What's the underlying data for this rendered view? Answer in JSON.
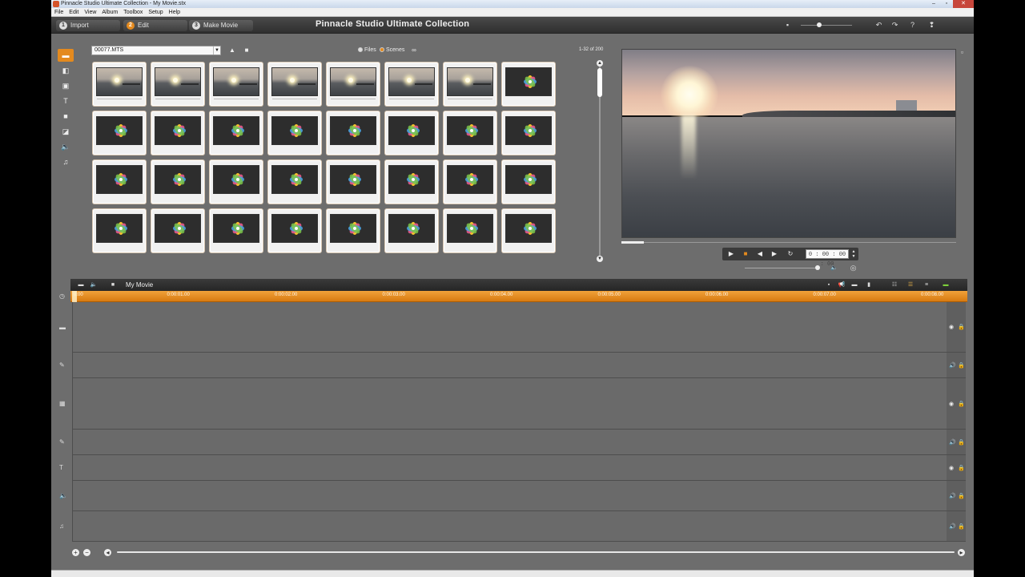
{
  "window": {
    "title": "Pinnacle Studio Ultimate Collection - My Movie.stx"
  },
  "menu": [
    "File",
    "Edit",
    "View",
    "Album",
    "Toolbox",
    "Setup",
    "Help"
  ],
  "nav": {
    "tabs": [
      {
        "num": "1",
        "label": "Import"
      },
      {
        "num": "2",
        "label": "Edit"
      },
      {
        "num": "3",
        "label": "Make Movie"
      }
    ],
    "active_tab": "Edit",
    "app_title": "Pinnacle Studio Ultimate Collection"
  },
  "toolbar_icons": [
    "video-scenes-icon",
    "transitions-icon",
    "photos-icon",
    "titles-icon",
    "menus-icon",
    "effects-icon",
    "sound-effects-icon",
    "music-icon"
  ],
  "library": {
    "file_selected": "00077.MTS",
    "view_files_label": "Files",
    "view_scenes_label": "Scenes",
    "selected_view": "Scenes",
    "count_text": "1-32 of 200",
    "thumbs": [
      "video",
      "video",
      "video",
      "video",
      "video",
      "video",
      "video",
      "photo",
      "photo",
      "photo",
      "photo",
      "photo",
      "photo",
      "photo",
      "photo",
      "photo",
      "photo",
      "photo",
      "photo",
      "photo",
      "photo",
      "photo",
      "photo",
      "photo",
      "photo",
      "photo",
      "photo",
      "photo",
      "photo",
      "photo",
      "photo",
      "photo"
    ]
  },
  "player": {
    "timecode": "0 : 00 : 00 : 00",
    "scrub_position_fraction": 0.0
  },
  "timeline": {
    "title": "My Movie",
    "ruler_labels": [
      "0:00",
      "0:00:01.00",
      "0:00:02.00",
      "0:00:03.00",
      "0:00:04.00",
      "0:00:05.00",
      "0:00:06.00",
      "0:00:07.00",
      "0:00:08.00"
    ],
    "tracks": [
      {
        "kind": "video",
        "left_icon": "video-track-icon",
        "right_icon": "eye-icon"
      },
      {
        "kind": "audio",
        "left_icon": "pencil-icon",
        "right_icon": "speaker-icon"
      },
      {
        "kind": "overlay",
        "left_icon": "overlay-track-icon",
        "right_icon": "eye-icon"
      },
      {
        "kind": "audio",
        "left_icon": "pencil-icon",
        "right_icon": "speaker-icon"
      },
      {
        "kind": "title",
        "left_icon": "title-track-icon",
        "right_icon": "eye-icon"
      },
      {
        "kind": "sound",
        "left_icon": "sound-track-icon",
        "right_icon": "speaker-icon"
      },
      {
        "kind": "music",
        "left_icon": "music-track-icon",
        "right_icon": "speaker-icon"
      }
    ]
  },
  "colors": {
    "accent": "#e48a1e",
    "background": "#6b6b6b",
    "navbar": "#2f2f2f"
  }
}
